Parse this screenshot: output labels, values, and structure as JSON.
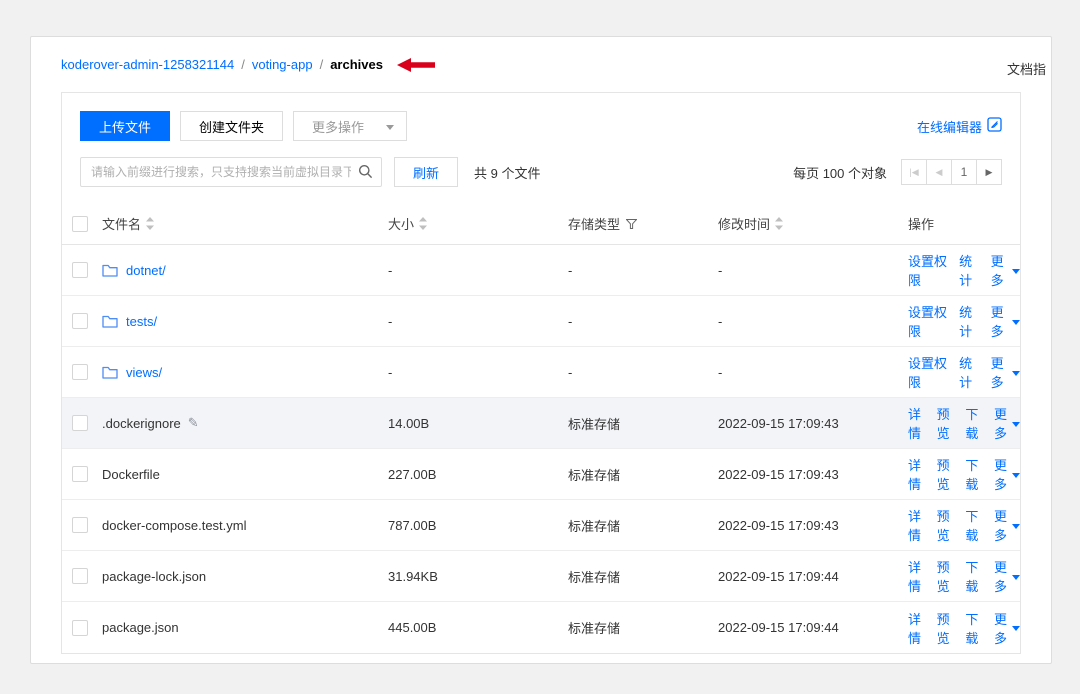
{
  "breadcrumb": {
    "links": [
      "koderover-admin-1258321144",
      "voting-app"
    ],
    "current": "archives",
    "doc_link": "文档指"
  },
  "toolbar": {
    "upload_label": "上传文件",
    "create_folder_label": "创建文件夹",
    "more_ops_label": "更多操作",
    "online_editor_label": "在线编辑器"
  },
  "search": {
    "placeholder": "请输入前缀进行搜索，只支持搜索当前虚拟目录下的对象",
    "refresh_label": "刷新",
    "count_text": "共 9 个文件"
  },
  "pagination": {
    "per_page_label": "每页 100 个对象",
    "first_label": "|◀",
    "prev_label": "◀",
    "current_page": "1",
    "next_label": "▶"
  },
  "table": {
    "headers": {
      "name": "文件名",
      "size": "大小",
      "storage": "存储类型",
      "modified": "修改时间",
      "actions": "操作"
    },
    "rows": [
      {
        "type": "folder",
        "name": "dotnet/",
        "size": "-",
        "storage": "-",
        "modified": "-",
        "actions": [
          "设置权限",
          "统计",
          "更多"
        ]
      },
      {
        "type": "folder",
        "name": "tests/",
        "size": "-",
        "storage": "-",
        "modified": "-",
        "actions": [
          "设置权限",
          "统计",
          "更多"
        ]
      },
      {
        "type": "folder",
        "name": "views/",
        "size": "-",
        "storage": "-",
        "modified": "-",
        "actions": [
          "设置权限",
          "统计",
          "更多"
        ]
      },
      {
        "type": "file",
        "name": ".dockerignore",
        "editable": true,
        "highlighted": true,
        "size": "14.00B",
        "storage": "标准存储",
        "modified": "2022-09-15 17:09:43",
        "actions": [
          "详情",
          "预览",
          "下载",
          "更多"
        ]
      },
      {
        "type": "file",
        "name": "Dockerfile",
        "size": "227.00B",
        "storage": "标准存储",
        "modified": "2022-09-15 17:09:43",
        "actions": [
          "详情",
          "预览",
          "下载",
          "更多"
        ]
      },
      {
        "type": "file",
        "name": "docker-compose.test.yml",
        "size": "787.00B",
        "storage": "标准存储",
        "modified": "2022-09-15 17:09:43",
        "actions": [
          "详情",
          "预览",
          "下载",
          "更多"
        ]
      },
      {
        "type": "file",
        "name": "package-lock.json",
        "size": "31.94KB",
        "storage": "标准存储",
        "modified": "2022-09-15 17:09:44",
        "actions": [
          "详情",
          "预览",
          "下载",
          "更多"
        ]
      },
      {
        "type": "file",
        "name": "package.json",
        "size": "445.00B",
        "storage": "标准存储",
        "modified": "2022-09-15 17:09:44",
        "actions": [
          "详情",
          "预览",
          "下载",
          "更多"
        ]
      }
    ]
  },
  "colors": {
    "accent": "#006eff",
    "arrow_red": "#d9001b"
  }
}
